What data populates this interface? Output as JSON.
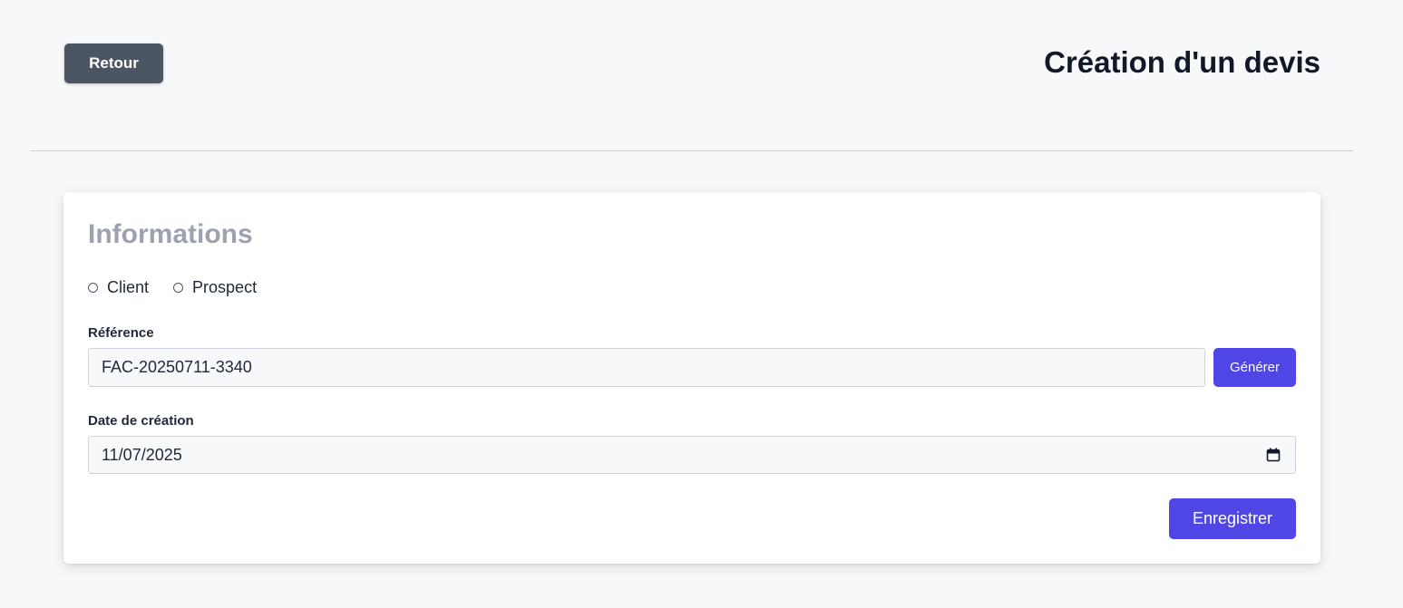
{
  "header": {
    "back_label": "Retour",
    "title": "Création d'un devis"
  },
  "form": {
    "section_title": "Informations",
    "type_options": [
      {
        "label": "Client",
        "selected": false
      },
      {
        "label": "Prospect",
        "selected": false
      }
    ],
    "reference": {
      "label": "Référence",
      "value": "FAC-20250711-3340",
      "generate_label": "Générer"
    },
    "creation_date": {
      "label": "Date de création",
      "value": "11/07/2025",
      "icon": "calendar-icon"
    },
    "save_label": "Enregistrer"
  },
  "colors": {
    "primary": "#4f46e5",
    "back_button": "#4b5563",
    "background": "#f7f8fa",
    "section_title": "#9ca3af"
  }
}
